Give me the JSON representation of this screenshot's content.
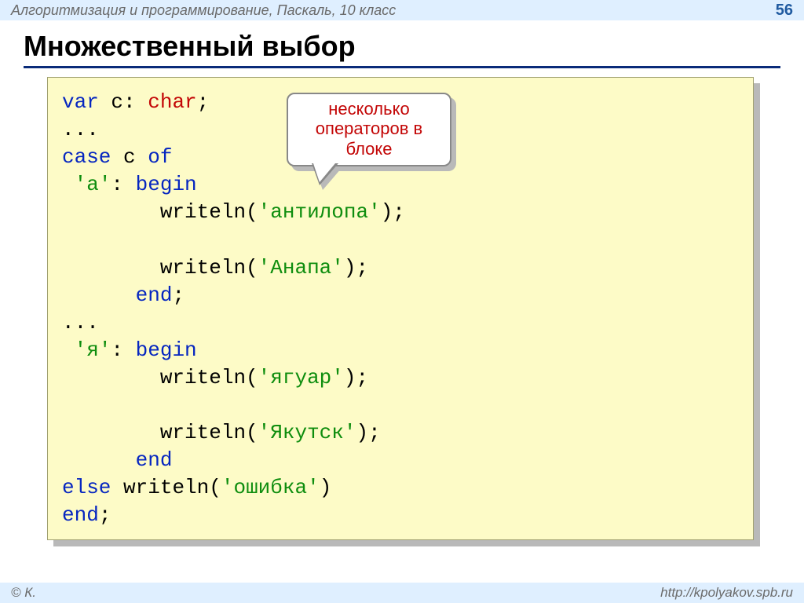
{
  "header": {
    "course": "Алгоритмизация и программирование, Паскаль, 10 класс",
    "page": "56"
  },
  "title": "Множественный выбор",
  "callout": "несколько операторов в блоке",
  "code": {
    "t": {
      "var": "var",
      "char": "char",
      "case": "case",
      "of": "of",
      "begin": "begin",
      "end": "end",
      "else": "else",
      "writeln": "writeln",
      "c_decl_mid": " c: ",
      "semi": ";",
      "colon_sp": ": ",
      "dots": "...",
      "c_of_mid": " c ",
      "open": "(",
      "close": ")",
      "sq_a": "'а'",
      "sq_ya": "'я'",
      "s_antilopa": "'антилопа'",
      "s_anapa": "'Анапа'",
      "s_jaguar": "'ягуар'",
      "s_yakutsk": "'Якутск'",
      "s_error": "'ошибка'"
    },
    "indent": {
      "i1": " ",
      "i2": "        ",
      "i3": "      "
    }
  },
  "footer": {
    "left": "© К.",
    "right": "http://kpolyakov.spb.ru"
  }
}
